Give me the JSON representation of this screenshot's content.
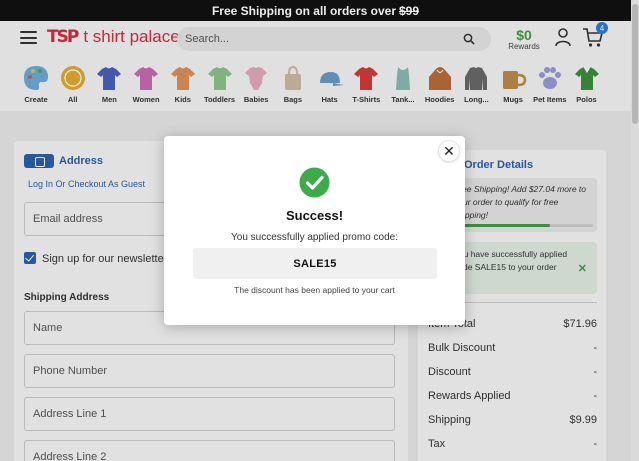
{
  "banner": {
    "text": "Free Shipping on all orders over",
    "amount": "$99"
  },
  "header": {
    "logo_mark": "TSP",
    "logo_text": "t shirt palace",
    "search_placeholder": "Search...",
    "rewards_amount": "$0",
    "rewards_label": "Rewards",
    "cart_count": "4"
  },
  "categories": [
    {
      "label": "Create",
      "icon": "palette-icon",
      "color": "#6aa8d8"
    },
    {
      "label": "All",
      "icon": "badge-icon",
      "color": "#e0a830"
    },
    {
      "label": "Men",
      "icon": "tshirt-icon",
      "color": "#4a5fb8"
    },
    {
      "label": "Women",
      "icon": "tshirt-icon",
      "color": "#c46ab0"
    },
    {
      "label": "Kids",
      "icon": "tshirt-icon",
      "color": "#d89058"
    },
    {
      "label": "Toddlers",
      "icon": "tshirt-icon",
      "color": "#8cc088"
    },
    {
      "label": "Babies",
      "icon": "onesie-icon",
      "color": "#e0a8b8"
    },
    {
      "label": "Bags",
      "icon": "bag-icon",
      "color": "#c8b8a0"
    },
    {
      "label": "Hats",
      "icon": "hat-icon",
      "color": "#6a98c0"
    },
    {
      "label": "T-Shirts",
      "icon": "tshirt-icon",
      "color": "#d03a3a"
    },
    {
      "label": "Tank...",
      "icon": "tank-icon",
      "color": "#88b8b0"
    },
    {
      "label": "Hoodies",
      "icon": "hoodie-icon",
      "color": "#b86a38"
    },
    {
      "label": "Long...",
      "icon": "longsleeve-icon",
      "color": "#686868"
    },
    {
      "label": "Mugs",
      "icon": "mug-icon",
      "color": "#b88a48"
    },
    {
      "label": "Pet Items",
      "icon": "paw-icon",
      "color": "#9898d8"
    },
    {
      "label": "Polos",
      "icon": "polo-icon",
      "color": "#3c8c3c"
    }
  ],
  "checkout": {
    "address_title": "Address",
    "guest_link": "Log In Or Checkout As Guest",
    "email_placeholder": "Email address",
    "newsletter_label": "Sign up for our newsletter",
    "shipping_title": "Shipping Address",
    "name_placeholder": "Name",
    "phone_placeholder": "Phone Number",
    "address1_placeholder": "Address Line 1",
    "address2_placeholder": "Address Line 2"
  },
  "order": {
    "title": "Order Details",
    "free_shipping_text": "Free Shipping! Add $27.04 more to your order to qualify for free shipping!",
    "free_shipping_progress": 0.73,
    "promo_text": "You have successfully applied code SALE15 to your order",
    "rows": [
      {
        "label": "Item Total",
        "value": "$71.96"
      },
      {
        "label": "Bulk Discount",
        "value": "-"
      },
      {
        "label": "Discount",
        "value": "-"
      },
      {
        "label": "Rewards Applied",
        "value": "-"
      },
      {
        "label": "Shipping",
        "value": "$9.99"
      },
      {
        "label": "Tax",
        "value": "-"
      }
    ]
  },
  "modal": {
    "title": "Success!",
    "message": "You successfully applied promo code:",
    "code": "SALE15",
    "note": "The discount has been applied to your cart",
    "close_symbol": "✕",
    "accent": "#3cab4a"
  }
}
